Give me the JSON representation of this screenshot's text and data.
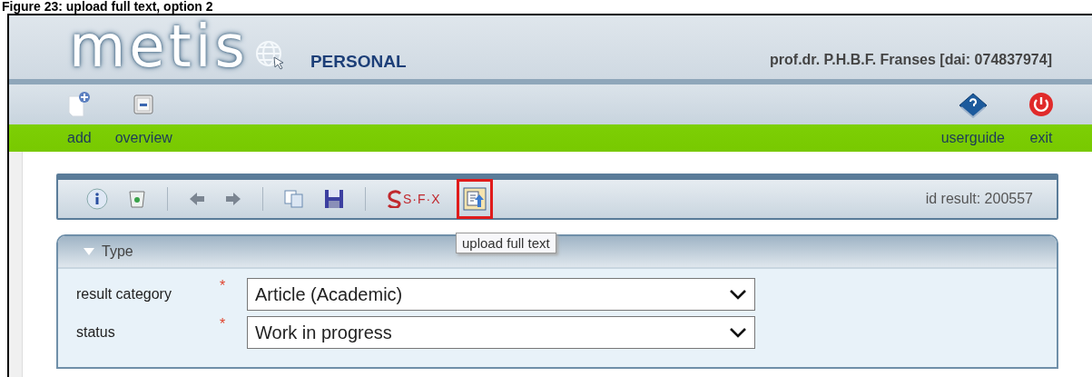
{
  "caption": "Figure 23: upload full text, option 2",
  "header": {
    "logo": "metis",
    "edition": "PERSONAL",
    "user": "prof.dr. P.H.B.F. Franses [dai: 074837974]"
  },
  "nav_left": [
    {
      "kind": "add",
      "label": "add"
    },
    {
      "kind": "overview",
      "label": "overview"
    }
  ],
  "nav_right": [
    {
      "kind": "userguide",
      "label": "userguide"
    },
    {
      "kind": "exit",
      "label": "exit"
    }
  ],
  "toolbar": {
    "items": [
      {
        "kind": "info",
        "highlighted": false
      },
      {
        "kind": "recycle",
        "highlighted": false
      },
      {
        "kind": "separator"
      },
      {
        "kind": "back",
        "highlighted": false
      },
      {
        "kind": "forward",
        "highlighted": false
      },
      {
        "kind": "separator"
      },
      {
        "kind": "copy",
        "highlighted": false
      },
      {
        "kind": "save",
        "highlighted": false
      },
      {
        "kind": "separator"
      },
      {
        "kind": "sfx",
        "label": "S·F·X",
        "highlighted": false
      },
      {
        "kind": "upload",
        "highlighted": true
      }
    ],
    "id_result": "id result: 200557",
    "tooltip": "upload full text"
  },
  "section": {
    "title": "Type",
    "expanded": true,
    "fields": [
      {
        "label": "result category",
        "required_mark": "*",
        "value": "Article (Academic)"
      },
      {
        "label": "status",
        "required_mark": "*",
        "value": "Work in progress"
      }
    ]
  }
}
